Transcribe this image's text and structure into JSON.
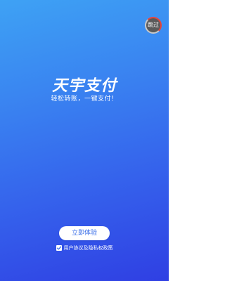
{
  "splash": {
    "skip_label": "跳过",
    "title": "天宇支付",
    "slogan": "轻松转账，一键支付！",
    "experience_label": "立即体验",
    "agreement_text": "用户协议及隐私权政策",
    "agreement_checked": true
  },
  "colors": {
    "gradient_top": "#3ea2f4",
    "gradient_bottom": "#2f3fe3",
    "button_text": "#3b6fe8",
    "skip_ring_accent": "#e8453c"
  },
  "icons": {
    "checkbox": "checkmark-icon"
  }
}
